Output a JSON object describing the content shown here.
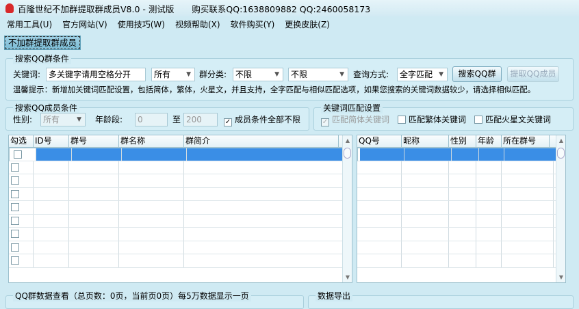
{
  "title": {
    "app": "百隆世纪不加群提取群成员V8.0 - 测试版",
    "contact": "购买联系QQ:1638809882 QQ:2460058173"
  },
  "menu": [
    "常用工具(U)",
    "官方网站(V)",
    "使用技巧(W)",
    "视频帮助(X)",
    "软件购买(Y)",
    "更换皮肤(Z)"
  ],
  "tab": "不加群提取群成员",
  "search_group": {
    "title": "搜索QQ群条件",
    "keyword_label": "关键词:",
    "keyword_value": "多关键字请用空格分开",
    "scope": "所有",
    "category_label": "群分类:",
    "category1": "不限",
    "category2": "不限",
    "query_label": "查询方式:",
    "query_mode": "全字匹配",
    "search_btn": "搜索QQ群",
    "extract_btn": "提取QQ成员",
    "tip": "温馨提示：新增加关键词匹配设置，包括简体，繁体，火星文，并且支持，全字匹配与相似匹配选项，如果您搜索的关键词数据较少，请选择相似匹配。"
  },
  "member_group": {
    "title": "搜索QQ成员条件",
    "gender_label": "性别:",
    "gender": "所有",
    "age_label": "年龄段:",
    "age_from": "0",
    "to": "至",
    "age_to": "200",
    "unlimited": "成员条件全部不限"
  },
  "match_group": {
    "title": "关键词匹配设置",
    "simplified": "匹配简体关键词",
    "traditional": "匹配繁体关键词",
    "martian": "匹配火星文关键词"
  },
  "left_table": {
    "columns": [
      "勾选",
      "ID号",
      "群号",
      "群名称",
      "群简介"
    ]
  },
  "right_table": {
    "columns": [
      "QQ号",
      "昵称",
      "性别",
      "年龄",
      "所在群号"
    ]
  },
  "bottom": {
    "view_title": "QQ群数据查看（总页数：0页，当前页0页）每5万数据显示一页",
    "export_title": "数据导出"
  }
}
